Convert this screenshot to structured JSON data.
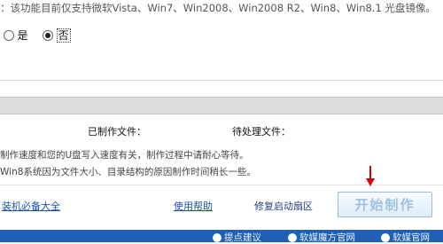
{
  "note": "：该功能目前仅支持微软Vista、Win7、Win2008、Win2008 R2、Win8、Win8.1 光盘镜像。",
  "options": {
    "yes_label": "是",
    "no_label": "否",
    "selected": "no"
  },
  "stats": {
    "made_label": "已制作文件：",
    "pending_label": "待处理文件："
  },
  "info": {
    "line1": "制作速度和您的U盘写入速度有关，制作过程中请耐心等待。",
    "line2": "Win8系统因为文件大小、目录结构的原因制作时间稍长一些。"
  },
  "links": {
    "essentials": "装机必备大全",
    "help": "使用帮助",
    "repair": "修复启动扇区"
  },
  "start_button": "开始制作",
  "bottom_bar": {
    "suggest": "提点建议",
    "official": "软媒魔方官网",
    "site": "软媒官网"
  },
  "colors": {
    "accent_blue": "#1f5fb6",
    "link_blue": "#1c4fa8",
    "arrow_red": "#d40000"
  }
}
